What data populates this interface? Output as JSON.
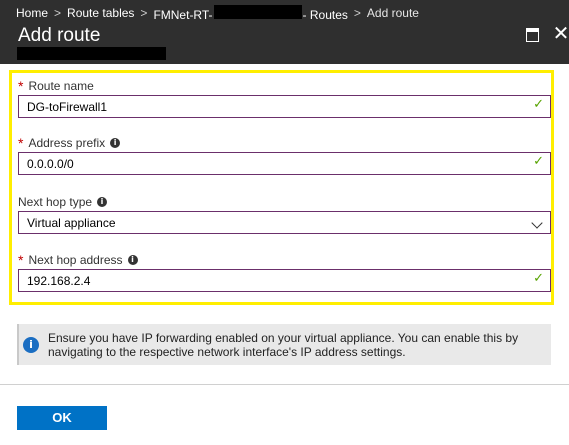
{
  "breadcrumb": {
    "home": "Home",
    "route_tables": "Route tables",
    "route_table_prefix": "FMNet-RT-",
    "route_table_suffix": "- Routes",
    "current": "Add route",
    "separator": ">"
  },
  "header": {
    "title": "Add route",
    "close_glyph": "✕"
  },
  "form": {
    "required_marker": "*",
    "route_name": {
      "label": "Route name",
      "value": "DG-toFirewall1",
      "valid": true
    },
    "address_prefix": {
      "label": "Address prefix",
      "value": "0.0.0.0/0",
      "valid": true
    },
    "next_hop_type": {
      "label": "Next hop type",
      "value": "Virtual appliance"
    },
    "next_hop_address": {
      "label": "Next hop address",
      "value": "192.168.2.4",
      "valid": true
    }
  },
  "icons": {
    "info": "i",
    "check": "✓"
  },
  "info_message": "Ensure you have IP forwarding enabled on your virtual appliance. You can enable this by navigating to the respective network interface's IP address settings.",
  "buttons": {
    "ok": "OK"
  },
  "colors": {
    "header_bg": "#2f2f2f",
    "highlight": "#ffee00",
    "input_border": "#6b2f6b",
    "check": "#57a300",
    "required": "#c00000",
    "info_icon": "#1b6ec2",
    "primary_button": "#0072c6"
  }
}
